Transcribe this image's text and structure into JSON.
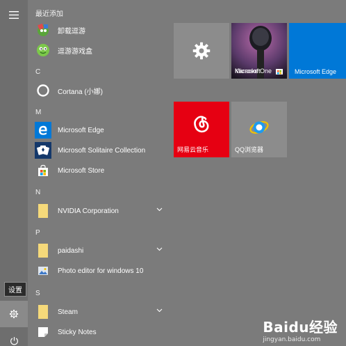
{
  "rail": {
    "menu_icon": "hamburger-icon",
    "settings_icon": "gear-icon",
    "power_icon": "power-icon",
    "tooltip": "设置"
  },
  "list": {
    "recent_header": "最近添加",
    "recent": [
      {
        "label": "卸载逗游",
        "icon": "game-uninstall-icon"
      },
      {
        "label": "逗游游戏盒",
        "icon": "game-box-icon"
      }
    ],
    "sections": [
      {
        "letter": "C",
        "items": [
          {
            "label": "Cortana (小娜)",
            "icon": "cortana-icon"
          }
        ]
      },
      {
        "letter": "M",
        "items": [
          {
            "label": "Microsoft Edge",
            "icon": "edge-icon"
          },
          {
            "label": "Microsoft Solitaire Collection",
            "icon": "solitaire-icon"
          },
          {
            "label": "Microsoft Store",
            "icon": "store-icon"
          }
        ]
      },
      {
        "letter": "N",
        "items": [
          {
            "label": "NVIDIA Corporation",
            "icon": "folder-icon"
          }
        ]
      },
      {
        "letter": "P",
        "items": [
          {
            "label": "paidashi",
            "icon": "folder-icon"
          },
          {
            "label": "Photo editor for windows 10",
            "icon": "photo-editor-icon"
          }
        ]
      },
      {
        "letter": "S",
        "items": [
          {
            "label": "Steam",
            "icon": "folder-icon"
          },
          {
            "label": "Sticky Notes",
            "icon": "sticky-notes-icon"
          }
        ]
      }
    ]
  },
  "tiles": {
    "settings": {
      "label": "",
      "icon": "gear-icon"
    },
    "karaoke": {
      "label_top": "Microsoft",
      "label_overlap": "Karaoke One"
    },
    "edge": {
      "label": "Microsoft Edge"
    },
    "netease": {
      "label": "网易云音乐"
    },
    "qq": {
      "label": "QQ浏览器"
    }
  },
  "watermark": {
    "main": "Baidu经验",
    "url": "jingyan.baidu.com"
  },
  "colors": {
    "background": "#7b7b7b",
    "tile_gray": "#8c8c8c",
    "edge_blue": "#0078d7",
    "netease_red": "#e60012",
    "folder_yellow": "#f5d97a"
  }
}
